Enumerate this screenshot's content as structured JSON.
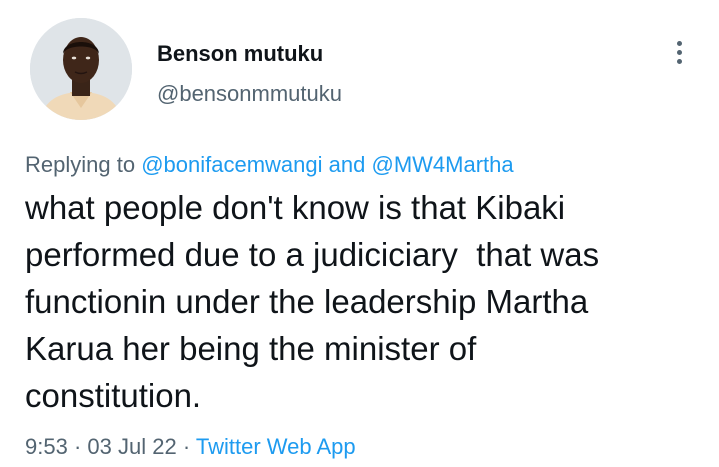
{
  "author": {
    "display_name": "Benson mutuku",
    "handle": "@bensonmmutuku",
    "avatar_icon": "profile-photo"
  },
  "more_icon": "more-vertical-icon",
  "reply": {
    "prefix": "Replying to",
    "mention_1": "@bonifacemwangi",
    "conjunction": "and",
    "mention_2": "@MW4Martha"
  },
  "tweet": {
    "lines": [
      "what people don't know is that Kibaki",
      "performed due to a judiciciary  that was",
      "functionin under the leadership Martha",
      "Karua her being the minister of",
      "constitution."
    ]
  },
  "meta": {
    "time": "9:53",
    "separator_1": "·",
    "date": "03 Jul 22",
    "separator_2": "·",
    "source": "Twitter Web App"
  },
  "colors": {
    "text": "#0f1419",
    "secondary": "#536471",
    "link": "#1d9bf0"
  }
}
